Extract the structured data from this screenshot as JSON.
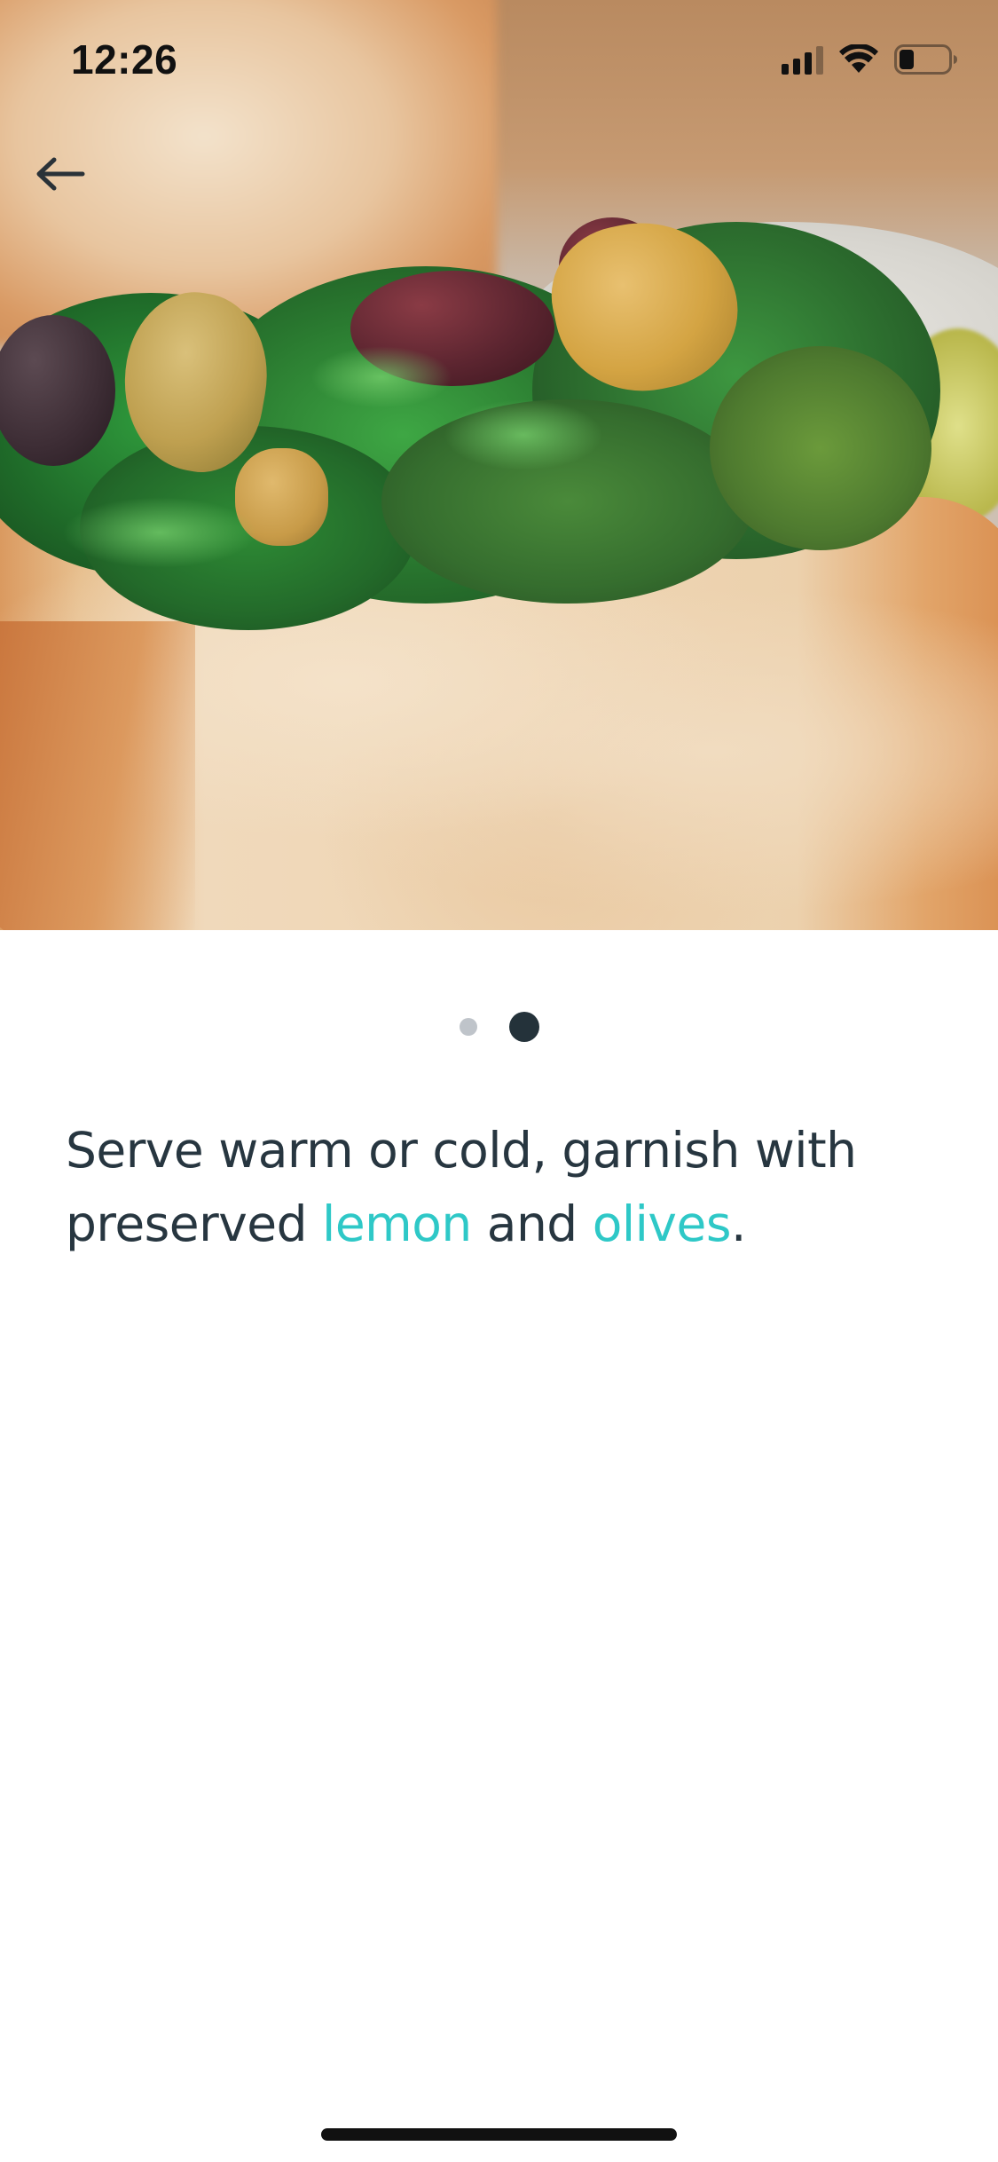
{
  "status_bar": {
    "time": "12:26",
    "icons": [
      "cellular-signal-icon",
      "wifi-icon",
      "battery-icon"
    ],
    "battery_level": 0.3
  },
  "navigation": {
    "back_icon": "arrow-left-icon"
  },
  "hero": {
    "image_subject": "bread slice topped with sauteed greens, olives and preserved lemon"
  },
  "pagination": {
    "total": 2,
    "current": 2
  },
  "instruction": {
    "part1": "Serve warm or cold, garnish with preserved ",
    "highlight1": "lemon",
    "part2": " and ",
    "highlight2": "olives",
    "part3": "."
  },
  "colors": {
    "text": "#273640",
    "highlight": "#2ec8c7",
    "dot_active": "#24323a",
    "dot_inactive": "#bfc4ca"
  }
}
